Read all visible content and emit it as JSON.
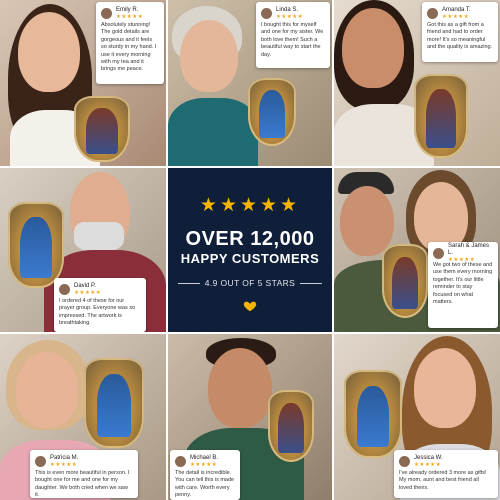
{
  "center": {
    "stars": "★★★★★",
    "headline": "OVER 12,000",
    "subheadline": "HAPPY CUSTOMERS",
    "rating_text": "4.9 OUT OF 5 STARS",
    "heart_icon": "heart-icon",
    "accent_color": "#f5b400",
    "background_color": "#0f1f3a"
  },
  "reviews": [
    {
      "name": "Emily R.",
      "stars": "★★★★★",
      "text": "Absolutely stunning! The gold details are gorgeous and it feels so sturdy in my hand. I use it every morning with my tea and it brings me peace."
    },
    {
      "name": "Linda S.",
      "stars": "★★★★★",
      "text": "I bought this for myself and one for my sister. We both love them! Such a beautiful way to start the day."
    },
    {
      "name": "Amanda T.",
      "stars": "★★★★★",
      "text": "Got this as a gift from a friend and had to order more! It's so meaningful and the quality is amazing."
    },
    {
      "name": "David P.",
      "stars": "★★★★★",
      "text": "I ordered 4 of these for our prayer group. Everyone was so impressed. The artwork is breathtaking."
    },
    {
      "name": "Sarah & James L.",
      "stars": "★★★★★",
      "text": "We got two of these and use them every morning together. It's our little reminder to stay focused on what matters."
    },
    {
      "name": "Patricia M.",
      "stars": "★★★★★",
      "text": "This is even more beautiful in person. I bought one for me and one for my daughter. We both cried when we saw it."
    },
    {
      "name": "Michael B.",
      "stars": "★★★★★",
      "text": "The detail is incredible. You can tell this is made with care. Worth every penny."
    },
    {
      "name": "Jessica W.",
      "stars": "★★★★★",
      "text": "I've already ordered 3 more as gifts! My mom, aunt and best friend all loved theirs."
    }
  ]
}
